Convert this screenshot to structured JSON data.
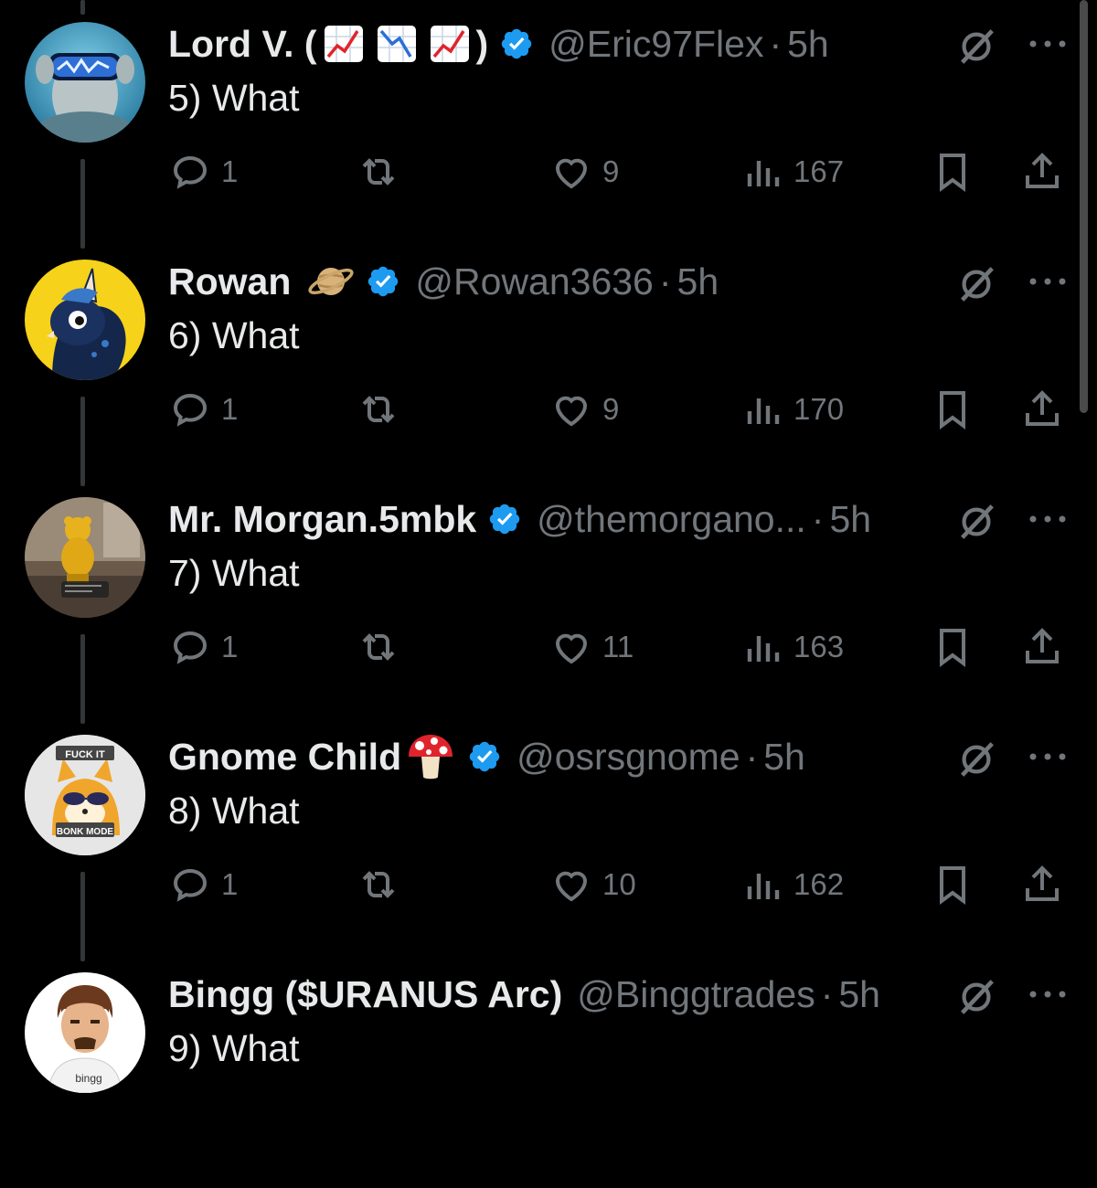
{
  "tweets": [
    {
      "name": "Lord V. (",
      "name_suffix": ")",
      "handle": "@Eric97Flex",
      "time": "5h",
      "text": "5) What",
      "replies": "1",
      "likes": "9",
      "views": "167",
      "avatar": "vr-goggles-avatar"
    },
    {
      "name": "Rowan",
      "handle": "@Rowan3636",
      "time": "5h",
      "text": "6) What",
      "replies": "1",
      "likes": "9",
      "views": "170",
      "avatar": "navy-unicorn-avatar"
    },
    {
      "name": "Mr. Morgan.5mbk",
      "handle": "@themorgano...",
      "time": "5h",
      "text": "7) What",
      "replies": "1",
      "likes": "11",
      "views": "163",
      "avatar": "gold-bear-avatar"
    },
    {
      "name": "Gnome Child",
      "handle": "@osrsgnome",
      "time": "5h",
      "text": "8) What",
      "replies": "1",
      "likes": "10",
      "views": "162",
      "avatar": "shiba-meme-avatar",
      "avatar_text_top": "FUCK IT",
      "avatar_text_bottom": "BONK MODE"
    },
    {
      "name": "Bingg ($URANUS Arc)",
      "handle": "@Binggtrades",
      "time": "5h",
      "text": "9) What",
      "avatar": "bingg-avatar",
      "avatar_text": "bingg"
    }
  ],
  "separator": "·",
  "colors": {
    "background": "#000000",
    "text": "#e7e9ea",
    "muted": "#71767b",
    "verified": "#1d9bf0",
    "thread_line": "#333639"
  },
  "icons": [
    "reply-icon",
    "repost-icon",
    "like-icon",
    "views-icon",
    "bookmark-icon",
    "share-icon",
    "grok-icon",
    "more-icon",
    "verified-icon"
  ]
}
